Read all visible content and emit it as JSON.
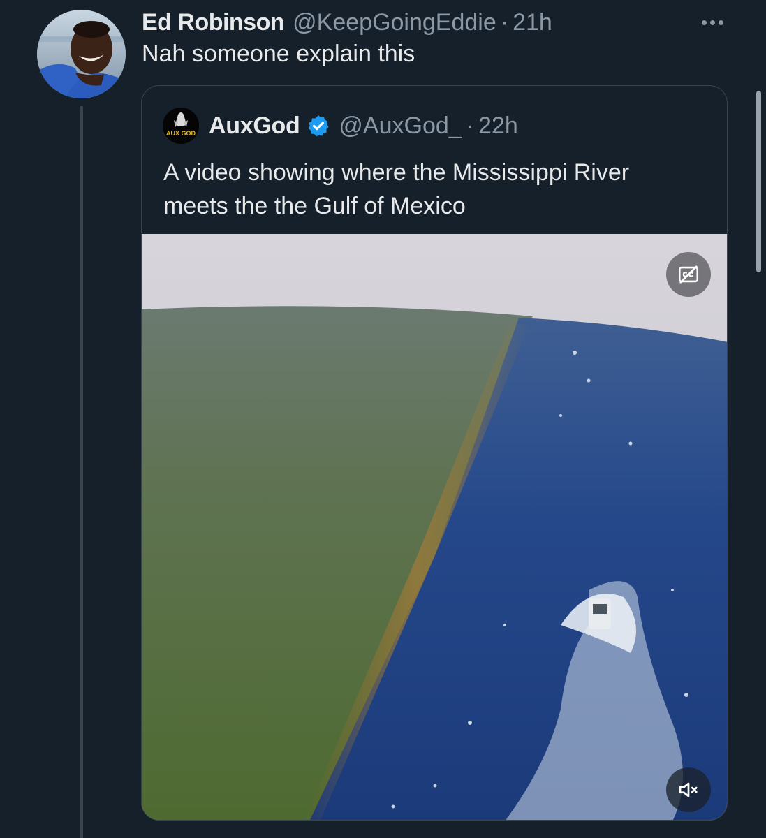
{
  "tweet": {
    "author": {
      "display_name": "Ed Robinson",
      "handle": "@KeepGoingEddie",
      "separator": "·",
      "time": "21h"
    },
    "text": "Nah someone explain this",
    "more_icon": "more-horizontal-icon"
  },
  "quoted_tweet": {
    "author": {
      "display_name": "AuxGod",
      "verified": true,
      "handle": "@AuxGod_",
      "separator": "·",
      "time": "22h",
      "avatar_text": "AUX GOD"
    },
    "text_lines": [
      "A video showing where the Mississippi River",
      "meets the the Gulf of Mexico"
    ],
    "media": {
      "type": "video",
      "controls": {
        "captions_icon": "captions-off-icon",
        "volume_icon": "volume-muted-icon"
      }
    }
  },
  "colors": {
    "background": "#15202b",
    "text_primary": "#e7e9ea",
    "text_secondary": "#8b98a5",
    "border": "#38444d",
    "verified_badge": "#1d9bf0"
  }
}
